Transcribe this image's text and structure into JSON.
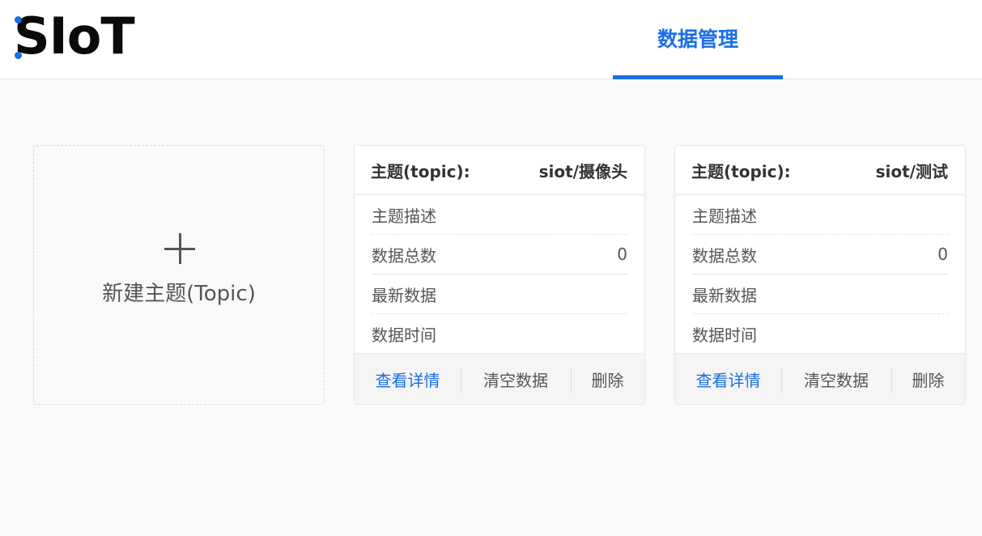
{
  "header": {
    "logo": "SIoT",
    "nav_tab": "数据管理"
  },
  "new_topic": {
    "label": "新建主题(Topic)"
  },
  "topics": [
    {
      "title_label": "主题(topic):",
      "name": "siot/摄像头",
      "rows": [
        {
          "label": "主题描述",
          "value": ""
        },
        {
          "label": "数据总数",
          "value": "0"
        },
        {
          "label": "最新数据",
          "value": ""
        },
        {
          "label": "数据时间",
          "value": ""
        }
      ],
      "actions": {
        "view": "查看详情",
        "clear": "清空数据",
        "delete": "删除"
      }
    },
    {
      "title_label": "主题(topic):",
      "name": "siot/测试",
      "rows": [
        {
          "label": "主题描述",
          "value": ""
        },
        {
          "label": "数据总数",
          "value": "0"
        },
        {
          "label": "最新数据",
          "value": ""
        },
        {
          "label": "数据时间",
          "value": ""
        }
      ],
      "actions": {
        "view": "查看详情",
        "clear": "清空数据",
        "delete": "删除"
      }
    }
  ],
  "colors": {
    "accent": "#1a6ee8",
    "background": "#f9f9f9",
    "text": "#555555"
  }
}
